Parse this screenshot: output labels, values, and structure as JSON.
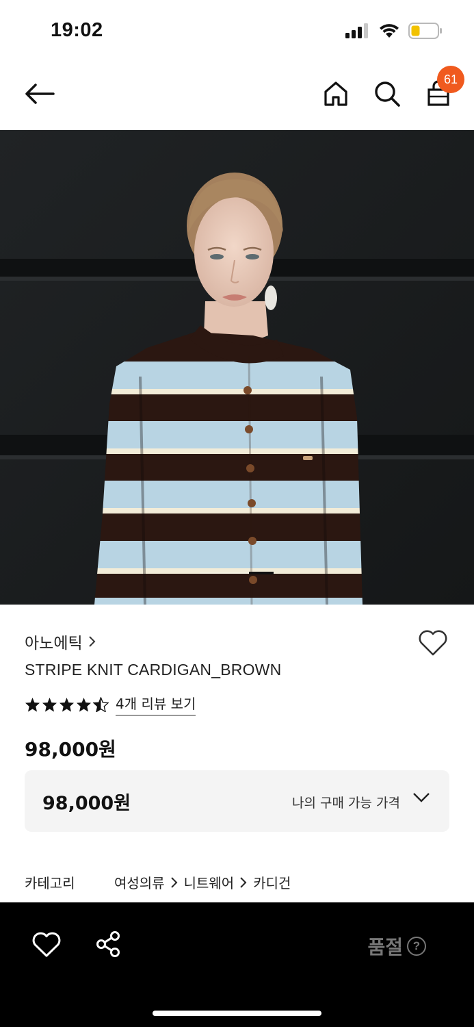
{
  "status_bar": {
    "time": "19:02",
    "icons": [
      "cellular-signal-icon",
      "wifi-icon",
      "battery-low-icon"
    ]
  },
  "nav": {
    "icons": [
      "back-arrow-icon",
      "home-icon",
      "search-icon",
      "shopping-bag-icon"
    ],
    "cart_count": "61"
  },
  "gallery": {
    "image_description": "product-photo",
    "pager_active_index": 2
  },
  "product": {
    "brand": "아노에틱",
    "name": "STRIPE KNIT CARDIGAN_BROWN",
    "rating": 4.5,
    "rating_max": 5,
    "review_link": "4개 리뷰 보기",
    "price": "98,000원",
    "my_price_value": "98,000원",
    "my_price_label": "나의 구매 가능 가격",
    "category_label": "카테고리",
    "category_path": [
      "여성의류",
      "니트웨어",
      "카디건"
    ]
  },
  "bottom_bar": {
    "status": "품절",
    "help_symbol": "?"
  },
  "colors": {
    "accent_badge": "#f05a1e",
    "bottom_bar_bg": "#000000",
    "price_box_bg": "#f4f4f4",
    "soldout_text": "#777777"
  }
}
